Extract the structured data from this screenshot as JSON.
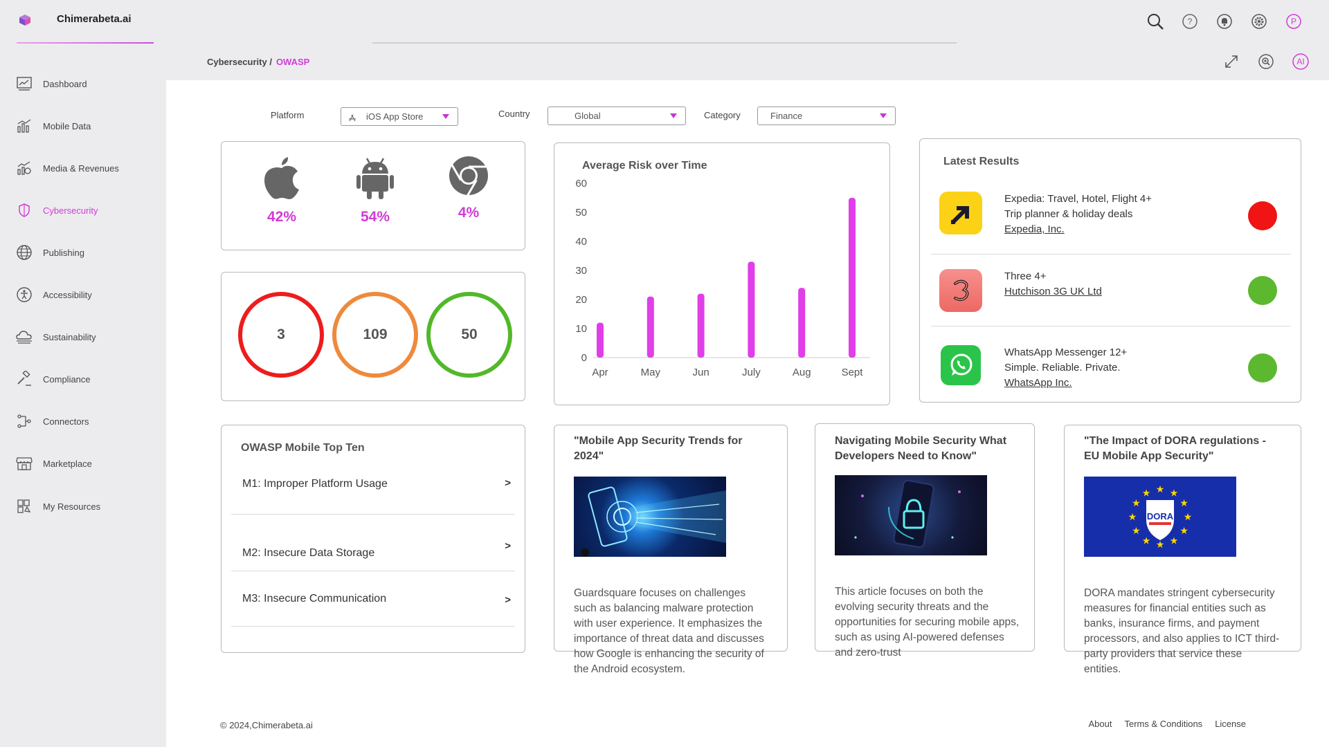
{
  "app": {
    "brand": "Chimerabeta.ai"
  },
  "top_icons": [
    "search-icon",
    "help-icon",
    "bell-icon",
    "settings-icon",
    "profile-avatar"
  ],
  "profile": {
    "initial": "P"
  },
  "sidebar": {
    "items": [
      {
        "label": "Dashboard",
        "icon": "dashboard-icon",
        "active": false
      },
      {
        "label": "Mobile Data",
        "icon": "bar-chart-icon",
        "active": false
      },
      {
        "label": "Media & Revenues",
        "icon": "media-revenue-icon",
        "active": false
      },
      {
        "label": "Cybersecurity",
        "icon": "shield-icon",
        "active": true
      },
      {
        "label": "Publishing",
        "icon": "globe-icon",
        "active": false
      },
      {
        "label": "Accessibility",
        "icon": "accessibility-icon",
        "active": false
      },
      {
        "label": "Sustainability",
        "icon": "cloud-icon",
        "active": false
      },
      {
        "label": "Compliance",
        "icon": "gavel-icon",
        "active": false
      },
      {
        "label": "Connectors",
        "icon": "connectors-icon",
        "active": false
      },
      {
        "label": "Marketplace",
        "icon": "store-icon",
        "active": false
      },
      {
        "label": "My Resources",
        "icon": "resources-icon",
        "active": false
      }
    ]
  },
  "breadcrumb": {
    "parent": "Cybersecurity /",
    "current": "OWASP"
  },
  "crumb_icons": {
    "ai_label": "AI"
  },
  "filters": {
    "platform_label": "Platform",
    "platform_value": "iOS App Store",
    "country_label": "Country",
    "country_value": "Global",
    "category_label": "Category",
    "category_value": "Finance"
  },
  "platform_share": [
    {
      "icon": "apple-icon",
      "value": "42%"
    },
    {
      "icon": "android-icon",
      "value": "54%"
    },
    {
      "icon": "chrome-icon",
      "value": "4%"
    }
  ],
  "risk_counts": [
    {
      "value": "3",
      "color": "#ee1c1c"
    },
    {
      "value": "109",
      "color": "#ee8a3c"
    },
    {
      "value": "50",
      "color": "#52b82a"
    }
  ],
  "chart_data": {
    "type": "bar",
    "title": "Average Risk over Time",
    "categories": [
      "Apr",
      "May",
      "Jun",
      "July",
      "Aug",
      "Sept"
    ],
    "values": [
      12,
      21,
      22,
      33,
      24,
      55
    ],
    "ylim": [
      0,
      60
    ],
    "yticks": [
      0,
      10,
      20,
      30,
      40,
      50,
      60
    ],
    "color": "#e03ee8",
    "grid": false
  },
  "latest": {
    "title": "Latest Results",
    "items": [
      {
        "line1": "Expedia: Travel, Hotel, Flight 4+",
        "line2": "Trip planner & holiday deals",
        "publisher": "Expedia, Inc.",
        "status_color": "#f01414",
        "icon": "expedia-app-icon"
      },
      {
        "line1": "Three 4+",
        "line2": "",
        "publisher": "Hutchison 3G UK Ltd",
        "status_color": "#5cb82e",
        "icon": "three-app-icon"
      },
      {
        "line1": "WhatsApp Messenger 12+",
        "line2": "Simple. Reliable. Private.",
        "publisher": "WhatsApp Inc.",
        "status_color": "#5cb82e",
        "icon": "whatsapp-app-icon"
      }
    ]
  },
  "owasp": {
    "title": "OWASP Mobile Top Ten",
    "items": [
      {
        "label": "M1: Improper Platform Usage",
        "chevron": ">"
      },
      {
        "label": "M2: Insecure Data Storage",
        "chevron": ">"
      },
      {
        "label": "M3: Insecure Communication",
        "chevron": ">"
      }
    ]
  },
  "articles": [
    {
      "title": "\"Mobile App Security Trends for 2024\"",
      "body": "Guardsquare focuses on challenges such as balancing malware protection with user experience. It emphasizes the importance of threat data and discusses how Google is enhancing the security of the Android ecosystem."
    },
    {
      "title": "Navigating Mobile Security What Developers Need to Know\"",
      "body": "This article focuses on both the evolving security threats and the opportunities for securing mobile apps, such as using AI-powered defenses and zero-trust"
    },
    {
      "title": "\"The Impact of DORA regulations - EU Mobile App Security\"",
      "body": "DORA mandates stringent cybersecurity measures for financial entities such as banks, insurance firms, and payment processors, and also applies to ICT third-party providers that service these entities.",
      "badge": "DORA"
    }
  ],
  "footer": {
    "copyright": "© 2024,Chimerabeta.ai",
    "links": [
      "About",
      "Terms & Conditions",
      "License"
    ]
  }
}
